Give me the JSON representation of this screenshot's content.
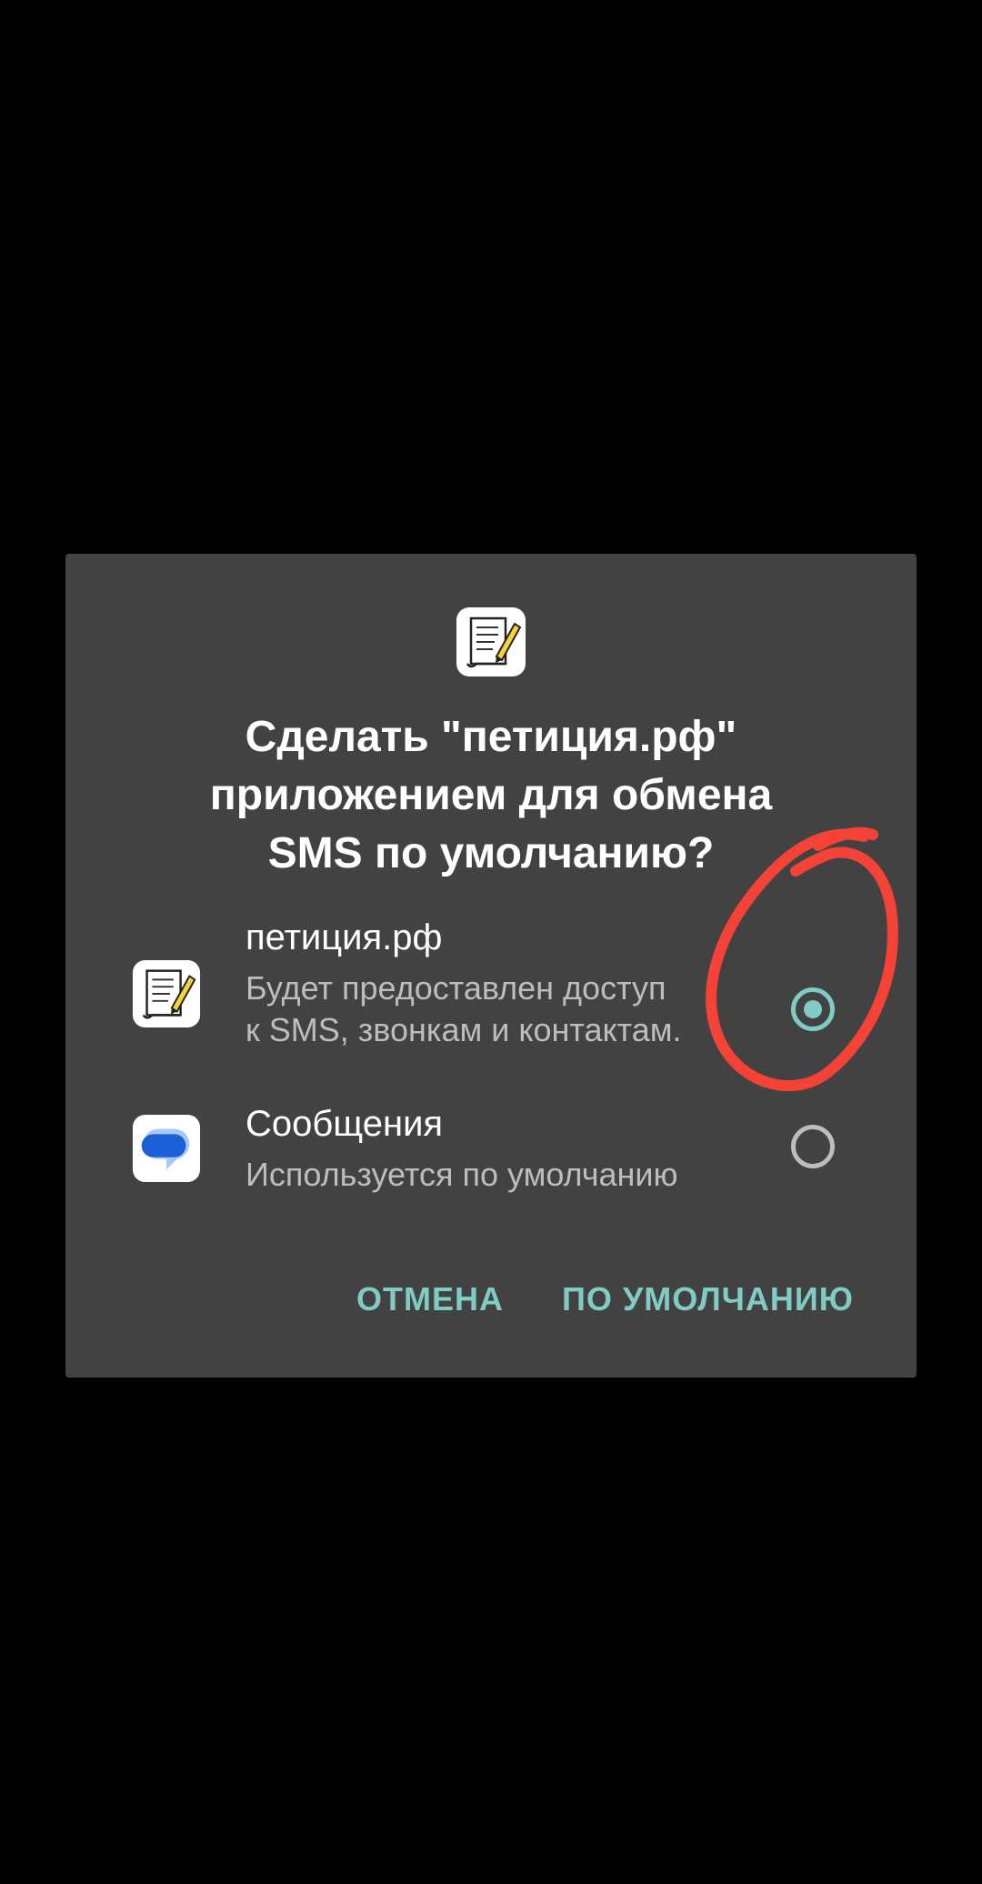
{
  "dialog": {
    "header_icon": "petition-scroll-pen-icon",
    "title": "Сделать \"петиция.рф\"\nприложением для обмена\nSMS по умолчанию?",
    "options": [
      {
        "icon": "petition-scroll-pen-icon",
        "name": "петиция.рф",
        "description": "Будет предоставлен доступ\nк SMS, звонкам и контактам.",
        "selected": true
      },
      {
        "icon": "messages-bubble-icon",
        "name": "Сообщения",
        "description": "Используется по умолчанию",
        "selected": false
      }
    ],
    "buttons": {
      "cancel": "ОТМЕНА",
      "set_default": "ПО УМОЛЧАНИЮ"
    }
  },
  "colors": {
    "background": "#000000",
    "dialog": "#424242",
    "accent": "#80cbc4",
    "secondary_text": "#bdbdbd",
    "annotation": "#f44336"
  }
}
